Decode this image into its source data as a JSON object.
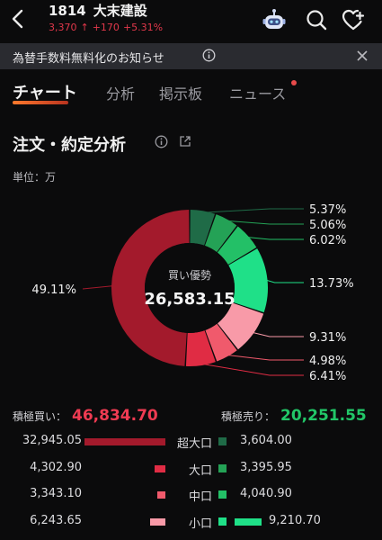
{
  "header": {
    "code": "1814",
    "name": "大末建設",
    "price": "3,370",
    "change": "+170",
    "change_pct": "+5.31%"
  },
  "notice": {
    "text": "為替手数料無料化のお知らせ"
  },
  "tabs": [
    {
      "label": "チャート",
      "active": true
    },
    {
      "label": "分析",
      "active": false
    },
    {
      "label": "掲示板",
      "active": false
    },
    {
      "label": "ニュース",
      "active": false
    }
  ],
  "section": {
    "title": "注文・約定分析",
    "unit": "単位：万"
  },
  "colors": {
    "buy_super": "#a31a2c",
    "buy_large": "#e02c44",
    "buy_mid": "#f05a6c",
    "buy_small": "#f89aa8",
    "sell_super": "#1f6b47",
    "sell_large": "#24a256",
    "sell_mid": "#23c067",
    "sell_small": "#1fe088",
    "accent_red": "#ef3b52",
    "accent_green": "#22c768"
  },
  "chart_data": {
    "type": "pie",
    "center_label": "買い優勢",
    "center_value": "26,583.15",
    "slices": [
      {
        "category": "sell-super",
        "label": "5.37%",
        "value": 5.37,
        "color": "#1f6b47"
      },
      {
        "category": "sell-large",
        "label": "5.06%",
        "value": 5.06,
        "color": "#24a256"
      },
      {
        "category": "sell-mid",
        "label": "6.02%",
        "value": 6.02,
        "color": "#23c067"
      },
      {
        "category": "sell-small",
        "label": "13.73%",
        "value": 13.73,
        "color": "#1fe088"
      },
      {
        "category": "buy-small",
        "label": "9.31%",
        "value": 9.31,
        "color": "#f89aa8"
      },
      {
        "category": "buy-mid",
        "label": "4.98%",
        "value": 4.98,
        "color": "#f05a6c"
      },
      {
        "category": "buy-large",
        "label": "6.41%",
        "value": 6.41,
        "color": "#e02c44"
      },
      {
        "category": "buy-super",
        "label": "49.11%",
        "value": 49.11,
        "color": "#a31a2c"
      }
    ]
  },
  "summary": {
    "buy_label": "積極買い：",
    "buy_value": "46,834.70",
    "sell_label": "積極売り：",
    "sell_value": "20,251.55"
  },
  "breakdown": [
    {
      "label": "超大口",
      "buy": "32,945.05",
      "sell": "3,604.00",
      "buy_num": 32945.05,
      "sell_num": 3604.0,
      "buy_color": "#a31a2c",
      "sell_color": "#1f6b47"
    },
    {
      "label": "大口",
      "buy": "4,302.90",
      "sell": "3,395.95",
      "buy_num": 4302.9,
      "sell_num": 3395.95,
      "buy_color": "#e02c44",
      "sell_color": "#24a256"
    },
    {
      "label": "中口",
      "buy": "3,343.10",
      "sell": "4,040.90",
      "buy_num": 3343.1,
      "sell_num": 4040.9,
      "buy_color": "#f05a6c",
      "sell_color": "#23c067"
    },
    {
      "label": "小口",
      "buy": "6,243.65",
      "sell": "9,210.70",
      "buy_num": 6243.65,
      "sell_num": 9210.7,
      "buy_color": "#f89aa8",
      "sell_color": "#1fe088"
    }
  ]
}
